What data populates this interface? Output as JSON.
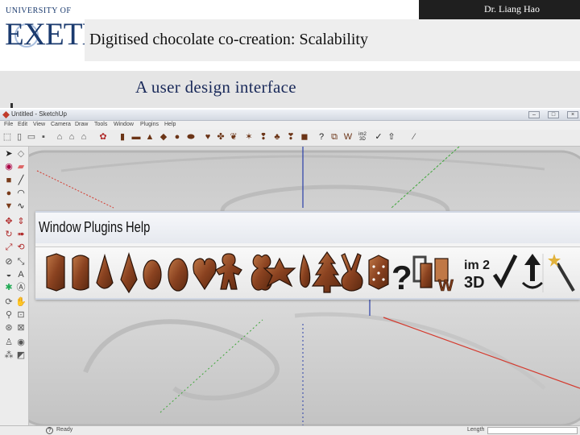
{
  "logo": {
    "line1": "UNIVERSITY OF",
    "line2": "EXETER"
  },
  "author": "Dr. Liang Hao",
  "slide_title": "Digitised chocolate co-creation: Scalability",
  "subtitle": "A user design interface",
  "app": {
    "window_title": "Untitled - SketchUp",
    "small_menu": [
      "File",
      "Edit",
      "View",
      "Camera",
      "Draw",
      "Tools",
      "Window",
      "Plugins",
      "Help"
    ],
    "window_buttons": [
      "–",
      "□",
      "×"
    ],
    "status_text": "Ready",
    "status_icon": "?",
    "measurements_label": "Length"
  },
  "zoomed_menu": [
    "Window",
    "Plugins",
    "Help"
  ],
  "zoomed_toolbar_icons": [
    "chocolate-bar-shape-icon",
    "cylinder-shape-icon",
    "drop-shape-icon",
    "cone-shape-icon",
    "egg-shape-icon",
    "oval-shape-icon",
    "heart-shape-icon",
    "gingerbread-man-icon",
    "teddy-bear-icon",
    "star-shape-icon",
    "teardrop-shape-icon",
    "christmas-tree-icon",
    "bunny-shape-icon",
    "dice-shape-icon",
    "help-icon",
    "copy-layers-icon",
    "imprint-w-icon",
    "im2-3d-icon",
    "checkmark-icon",
    "export-upload-icon",
    "magic-wand-icon"
  ],
  "im2_label": "im 2",
  "three_d_label": "3D",
  "colors": {
    "chocolate": "#7a3b1a",
    "axis_red": "#d43a2e",
    "axis_green": "#3fa63a",
    "axis_blue": "#2a3fa8"
  }
}
